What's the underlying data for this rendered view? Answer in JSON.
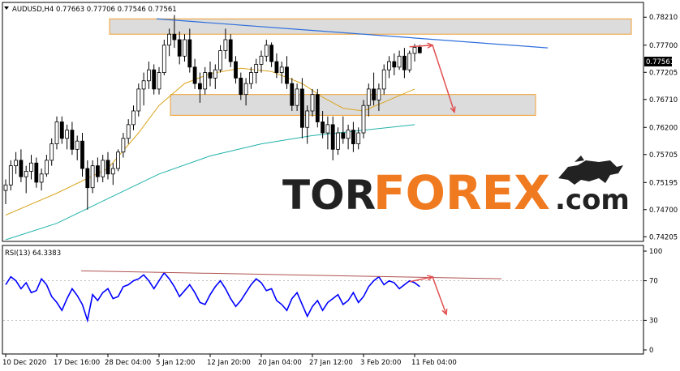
{
  "chart_data": [
    {
      "type": "candlestick",
      "symbol_header": "AUDUSD,H4  0.77663 0.77706 0.77546 0.77561",
      "current_price_label": "0.77561",
      "current_price": 0.77561,
      "ylim": [
        0.7415,
        0.7845
      ],
      "y_ticks": [
        "0.78210",
        "0.77700",
        "0.77205",
        "0.76710",
        "0.76200",
        "0.75705",
        "0.75195",
        "0.74700",
        "0.74205"
      ],
      "y_tick_values": [
        0.7821,
        0.777,
        0.77205,
        0.7671,
        0.762,
        0.75705,
        0.75195,
        0.747,
        0.74205
      ],
      "candles": [
        [
          0.7505,
          0.7525,
          0.748,
          0.7515
        ],
        [
          0.7515,
          0.756,
          0.7505,
          0.755
        ],
        [
          0.755,
          0.7575,
          0.7535,
          0.756
        ],
        [
          0.756,
          0.758,
          0.752,
          0.753
        ],
        [
          0.753,
          0.755,
          0.75,
          0.754
        ],
        [
          0.754,
          0.757,
          0.7525,
          0.7555
        ],
        [
          0.7555,
          0.7565,
          0.751,
          0.752
        ],
        [
          0.752,
          0.7545,
          0.7505,
          0.7535
        ],
        [
          0.7535,
          0.757,
          0.753,
          0.756
        ],
        [
          0.756,
          0.76,
          0.755,
          0.759
        ],
        [
          0.759,
          0.764,
          0.758,
          0.763
        ],
        [
          0.763,
          0.764,
          0.759,
          0.76
        ],
        [
          0.76,
          0.7625,
          0.758,
          0.7615
        ],
        [
          0.7615,
          0.763,
          0.757,
          0.758
        ],
        [
          0.758,
          0.7605,
          0.756,
          0.7595
        ],
        [
          0.7595,
          0.761,
          0.753,
          0.7545
        ],
        [
          0.7545,
          0.756,
          0.747,
          0.751
        ],
        [
          0.751,
          0.756,
          0.75,
          0.755
        ],
        [
          0.755,
          0.7565,
          0.752,
          0.753
        ],
        [
          0.753,
          0.757,
          0.752,
          0.756
        ],
        [
          0.756,
          0.7575,
          0.7525,
          0.7535
        ],
        [
          0.7535,
          0.7555,
          0.7515,
          0.7545
        ],
        [
          0.7545,
          0.758,
          0.754,
          0.7575
        ],
        [
          0.7575,
          0.761,
          0.7565,
          0.76
        ],
        [
          0.76,
          0.7635,
          0.759,
          0.7625
        ],
        [
          0.7625,
          0.766,
          0.7615,
          0.765
        ],
        [
          0.765,
          0.77,
          0.764,
          0.769
        ],
        [
          0.769,
          0.772,
          0.766,
          0.7705
        ],
        [
          0.7705,
          0.774,
          0.769,
          0.7725
        ],
        [
          0.7725,
          0.7735,
          0.768,
          0.769
        ],
        [
          0.769,
          0.773,
          0.768,
          0.772
        ],
        [
          0.772,
          0.778,
          0.7715,
          0.777
        ],
        [
          0.777,
          0.78,
          0.775,
          0.779
        ],
        [
          0.779,
          0.7825,
          0.7765,
          0.778
        ],
        [
          0.778,
          0.7795,
          0.7735,
          0.775
        ],
        [
          0.775,
          0.779,
          0.774,
          0.778
        ],
        [
          0.778,
          0.78,
          0.772,
          0.773
        ],
        [
          0.773,
          0.7745,
          0.769,
          0.77
        ],
        [
          0.77,
          0.772,
          0.7665,
          0.769
        ],
        [
          0.769,
          0.773,
          0.768,
          0.772
        ],
        [
          0.772,
          0.774,
          0.7695,
          0.771
        ],
        [
          0.771,
          0.7735,
          0.769,
          0.7725
        ],
        [
          0.7725,
          0.777,
          0.772,
          0.776
        ],
        [
          0.776,
          0.78,
          0.7745,
          0.778
        ],
        [
          0.778,
          0.779,
          0.773,
          0.774
        ],
        [
          0.774,
          0.775,
          0.77,
          0.771
        ],
        [
          0.771,
          0.772,
          0.767,
          0.768
        ],
        [
          0.768,
          0.771,
          0.766,
          0.77
        ],
        [
          0.77,
          0.773,
          0.769,
          0.772
        ],
        [
          0.772,
          0.7745,
          0.77,
          0.7735
        ],
        [
          0.7735,
          0.776,
          0.772,
          0.775
        ],
        [
          0.775,
          0.778,
          0.774,
          0.777
        ],
        [
          0.777,
          0.7775,
          0.773,
          0.774
        ],
        [
          0.774,
          0.7755,
          0.771,
          0.772
        ],
        [
          0.772,
          0.774,
          0.77,
          0.773
        ],
        [
          0.773,
          0.775,
          0.769,
          0.77
        ],
        [
          0.77,
          0.771,
          0.765,
          0.766
        ],
        [
          0.766,
          0.77,
          0.765,
          0.769
        ],
        [
          0.769,
          0.771,
          0.76,
          0.762
        ],
        [
          0.762,
          0.766,
          0.759,
          0.765
        ],
        [
          0.765,
          0.769,
          0.764,
          0.768
        ],
        [
          0.768,
          0.769,
          0.762,
          0.763
        ],
        [
          0.763,
          0.765,
          0.76,
          0.761
        ],
        [
          0.761,
          0.764,
          0.758,
          0.7625
        ],
        [
          0.7625,
          0.764,
          0.756,
          0.758
        ],
        [
          0.758,
          0.762,
          0.757,
          0.761
        ],
        [
          0.761,
          0.764,
          0.759,
          0.76
        ],
        [
          0.76,
          0.7625,
          0.758,
          0.7615
        ],
        [
          0.7615,
          0.763,
          0.7575,
          0.759
        ],
        [
          0.759,
          0.762,
          0.758,
          0.761
        ],
        [
          0.761,
          0.767,
          0.76,
          0.766
        ],
        [
          0.766,
          0.77,
          0.764,
          0.769
        ],
        [
          0.769,
          0.772,
          0.766,
          0.767
        ],
        [
          0.767,
          0.77,
          0.765,
          0.769
        ],
        [
          0.769,
          0.7735,
          0.768,
          0.7725
        ],
        [
          0.7725,
          0.775,
          0.771,
          0.774
        ],
        [
          0.774,
          0.7755,
          0.7715,
          0.773
        ],
        [
          0.773,
          0.776,
          0.7725,
          0.775
        ],
        [
          0.775,
          0.7765,
          0.771,
          0.7725
        ],
        [
          0.7725,
          0.776,
          0.772,
          0.7755
        ],
        [
          0.7755,
          0.7772,
          0.774,
          0.7766
        ],
        [
          0.77663,
          0.77706,
          0.77546,
          0.77561
        ]
      ],
      "x_ticks": [
        "10 Dec 2020",
        "17 Dec 16:00",
        "28 Dec 04:00",
        "5 Jan 12:00",
        "12 Jan 20:00",
        "20 Jan 04:00",
        "27 Jan 12:00",
        "3 Feb 20:00",
        "11 Feb 04:00"
      ],
      "x_tick_candle_index": [
        0,
        10,
        20,
        30,
        40,
        50,
        60,
        70,
        80
      ],
      "ma_slow": [
        [
          0,
          0.7415
        ],
        [
          10,
          0.7445
        ],
        [
          20,
          0.749
        ],
        [
          30,
          0.7535
        ],
        [
          40,
          0.7568
        ],
        [
          50,
          0.759
        ],
        [
          60,
          0.7605
        ],
        [
          70,
          0.7615
        ],
        [
          80,
          0.7625
        ]
      ],
      "ma_fast": [
        [
          0,
          0.746
        ],
        [
          10,
          0.75
        ],
        [
          20,
          0.7545
        ],
        [
          26,
          0.761
        ],
        [
          30,
          0.766
        ],
        [
          35,
          0.77
        ],
        [
          40,
          0.7718
        ],
        [
          46,
          0.7728
        ],
        [
          52,
          0.7722
        ],
        [
          58,
          0.77
        ],
        [
          62,
          0.7675
        ],
        [
          66,
          0.7655
        ],
        [
          70,
          0.765
        ],
        [
          75,
          0.767
        ],
        [
          80,
          0.769
        ]
      ],
      "resistance_zone": [
        0.779,
        0.7818
      ],
      "support_zone": [
        0.7642,
        0.768
      ],
      "trend_line": [
        [
          30,
          0.7818
        ],
        [
          85,
          0.7765
        ]
      ],
      "forecast_arrows": [
        [
          [
            79,
            0.7767
          ],
          [
            83,
            0.777
          ]
        ],
        [
          [
            83,
            0.777
          ],
          [
            86,
            0.7648
          ]
        ]
      ]
    },
    {
      "type": "line",
      "indicator_label": "RSI(13) 64.3383",
      "ylim": [
        0,
        100
      ],
      "y_ticks": [
        "100",
        "70",
        "30",
        "0"
      ],
      "y_tick_values": [
        100,
        70,
        30,
        0
      ],
      "levels": [
        70,
        30
      ],
      "values": [
        66,
        74,
        70,
        62,
        68,
        58,
        60,
        72,
        66,
        54,
        48,
        40,
        52,
        62,
        55,
        46,
        30,
        56,
        50,
        58,
        62,
        52,
        54,
        64,
        66,
        70,
        72,
        76,
        70,
        62,
        70,
        78,
        72,
        64,
        54,
        60,
        66,
        58,
        48,
        46,
        56,
        64,
        70,
        62,
        52,
        44,
        50,
        58,
        66,
        72,
        68,
        60,
        62,
        50,
        46,
        40,
        52,
        58,
        46,
        34,
        44,
        50,
        40,
        48,
        52,
        56,
        46,
        50,
        58,
        48,
        54,
        64,
        70,
        74,
        66,
        70,
        68,
        62,
        66,
        70,
        68,
        64
      ],
      "trend_line": [
        [
          10,
          80
        ],
        [
          90,
          72
        ]
      ],
      "forecast_arrows": [
        [
          [
            79,
            69
          ],
          [
            83,
            74
          ]
        ],
        [
          [
            83,
            74
          ],
          [
            86,
            36
          ]
        ]
      ]
    }
  ],
  "watermark": {
    "part1": "TOR",
    "part2": "FOREX",
    "part3": ".com"
  },
  "colors": {
    "candle": "#000000",
    "ma_slow": "#20b2aa",
    "ma_fast": "#daa520",
    "zone_fill": "#d3d3d3",
    "zone_border": "#f0a030",
    "trend_line": "#2f6fdc",
    "arrow": "#e05050",
    "rsi_line": "#0000ff",
    "rsi_trend": "#b05050",
    "logo_dark": "#222222",
    "logo_orange": "#f07a20"
  }
}
